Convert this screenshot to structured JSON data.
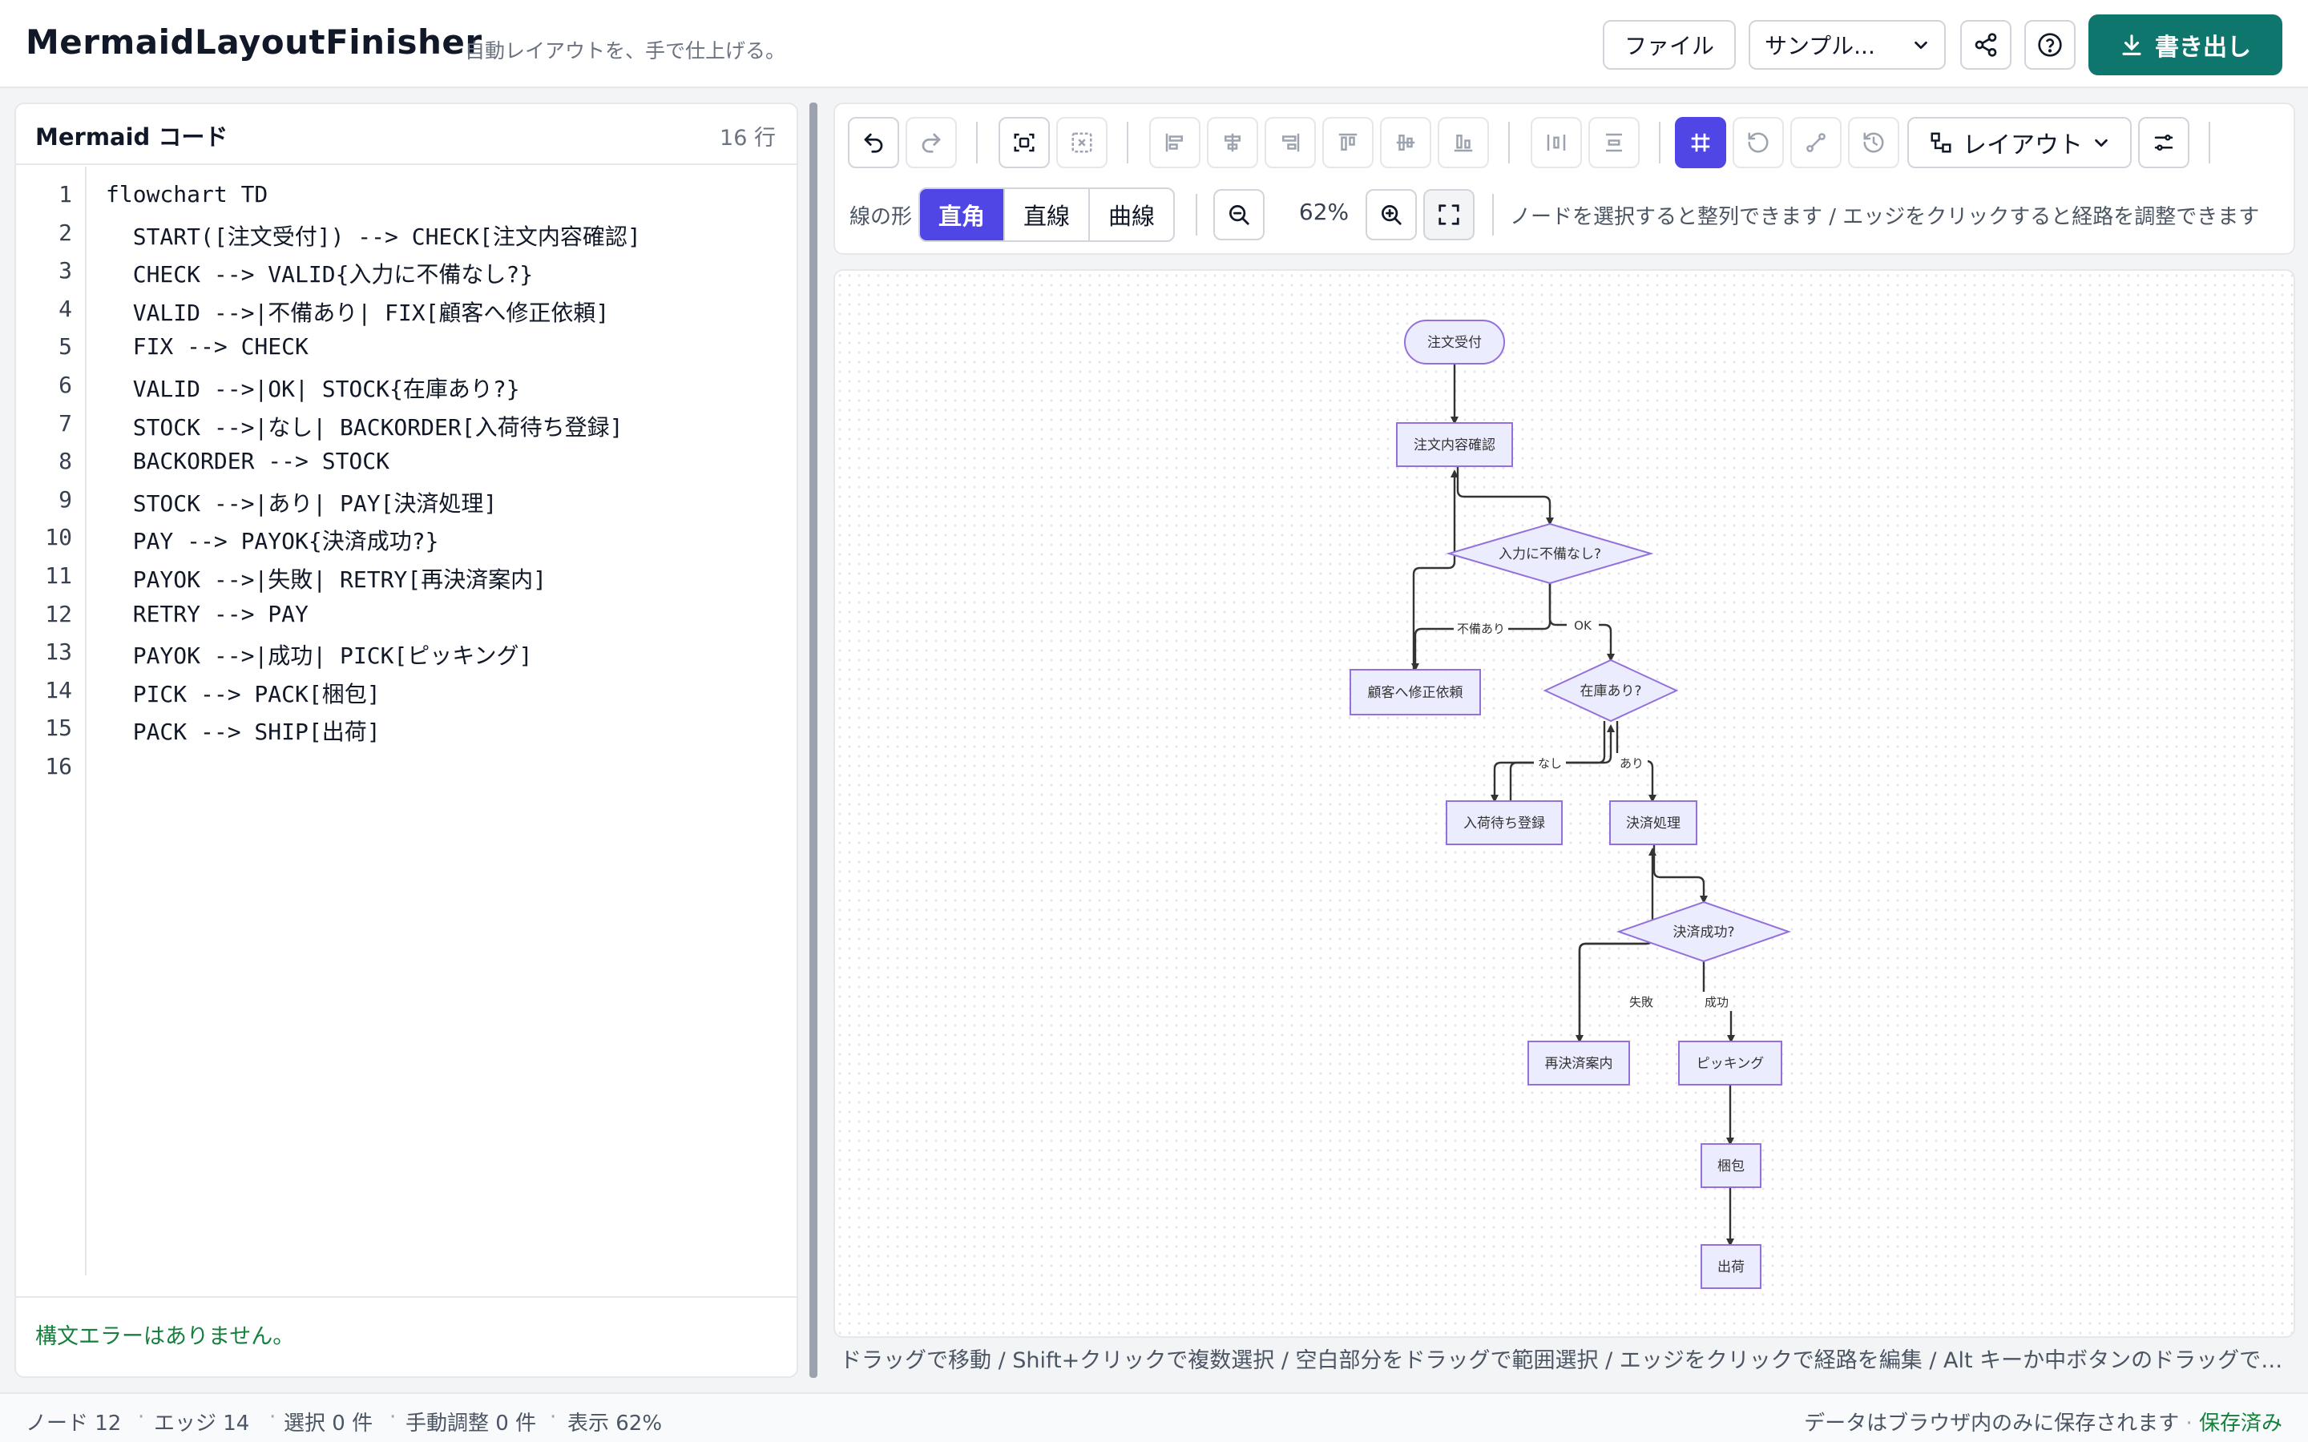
{
  "header": {
    "title": "MermaidLayoutFinisher",
    "subtitle": "自動レイアウトを、手で仕上げる。",
    "file_label": "ファイル",
    "sample_label": "サンプル...",
    "export_label": "書き出し"
  },
  "editor": {
    "title": "Mermaid コード",
    "line_count": "16 行",
    "lines": [
      {
        "no": "1",
        "text": "flowchart TD"
      },
      {
        "no": "2",
        "text": "  START([注文受付]) --> CHECK[注文内容確認]"
      },
      {
        "no": "3",
        "text": "  CHECK --> VALID{入力に不備なし?}"
      },
      {
        "no": "4",
        "text": "  VALID -->|不備あり| FIX[顧客へ修正依頼]"
      },
      {
        "no": "5",
        "text": "  FIX --> CHECK"
      },
      {
        "no": "6",
        "text": "  VALID -->|OK| STOCK{在庫あり?}"
      },
      {
        "no": "7",
        "text": "  STOCK -->|なし| BACKORDER[入荷待ち登録]"
      },
      {
        "no": "8",
        "text": "  BACKORDER --> STOCK"
      },
      {
        "no": "9",
        "text": "  STOCK -->|あり| PAY[決済処理]"
      },
      {
        "no": "10",
        "text": "  PAY --> PAYOK{決済成功?}"
      },
      {
        "no": "11",
        "text": "  PAYOK -->|失敗| RETRY[再決済案内]"
      },
      {
        "no": "12",
        "text": "  RETRY --> PAY"
      },
      {
        "no": "13",
        "text": "  PAYOK -->|成功| PICK[ピッキング]"
      },
      {
        "no": "14",
        "text": "  PICK --> PACK[梱包]"
      },
      {
        "no": "15",
        "text": "  PACK --> SHIP[出荷]"
      },
      {
        "no": "16",
        "text": ""
      }
    ],
    "status": "構文エラーはありません。"
  },
  "toolbar": {
    "layout_label": "レイアウト",
    "edge_style_label": "線の形",
    "edge_styles": [
      "直角",
      "直線",
      "曲線"
    ],
    "edge_style_selected": "直角",
    "zoom": "62%",
    "hint": "ノードを選択すると整列できます / エッジをクリックすると経路を調整できます",
    "grid_snap": true
  },
  "diagram": {
    "nodes": {
      "start": "注文受付",
      "check": "注文内容確認",
      "valid": "入力に不備なし?",
      "fix": "顧客へ修正依頼",
      "stock": "在庫あり?",
      "backorder": "入荷待ち登録",
      "pay": "決済処理",
      "payok": "決済成功?",
      "retry": "再決済案内",
      "pick": "ピッキング",
      "pack": "梱包",
      "ship": "出荷"
    },
    "edge_labels": {
      "fix": "不備あり",
      "ok": "OK",
      "none": "なし",
      "yes": "あり",
      "fail": "失敗",
      "success": "成功"
    }
  },
  "canvas_hint": "ドラッグで移動 / Shift+クリックで複数選択 / 空白部分をドラッグで範囲選択 / エッジをクリックで経路を編集 / Alt キーか中ボタンのドラッグで画面...",
  "statusbar": {
    "nodes": "ノード 12",
    "edges": "エッジ 14",
    "selected": "選択 0 件",
    "manual": "手動調整 0 件",
    "zoom": "表示 62%",
    "storage_note": "データはブラウザ内のみに保存されます",
    "separator": "·",
    "saved": "保存済み"
  },
  "colors": {
    "accent": "#4f46e5",
    "export": "#0f766e",
    "node_fill": "#ececff",
    "node_stroke": "#9370db",
    "success_text": "#15803d"
  }
}
